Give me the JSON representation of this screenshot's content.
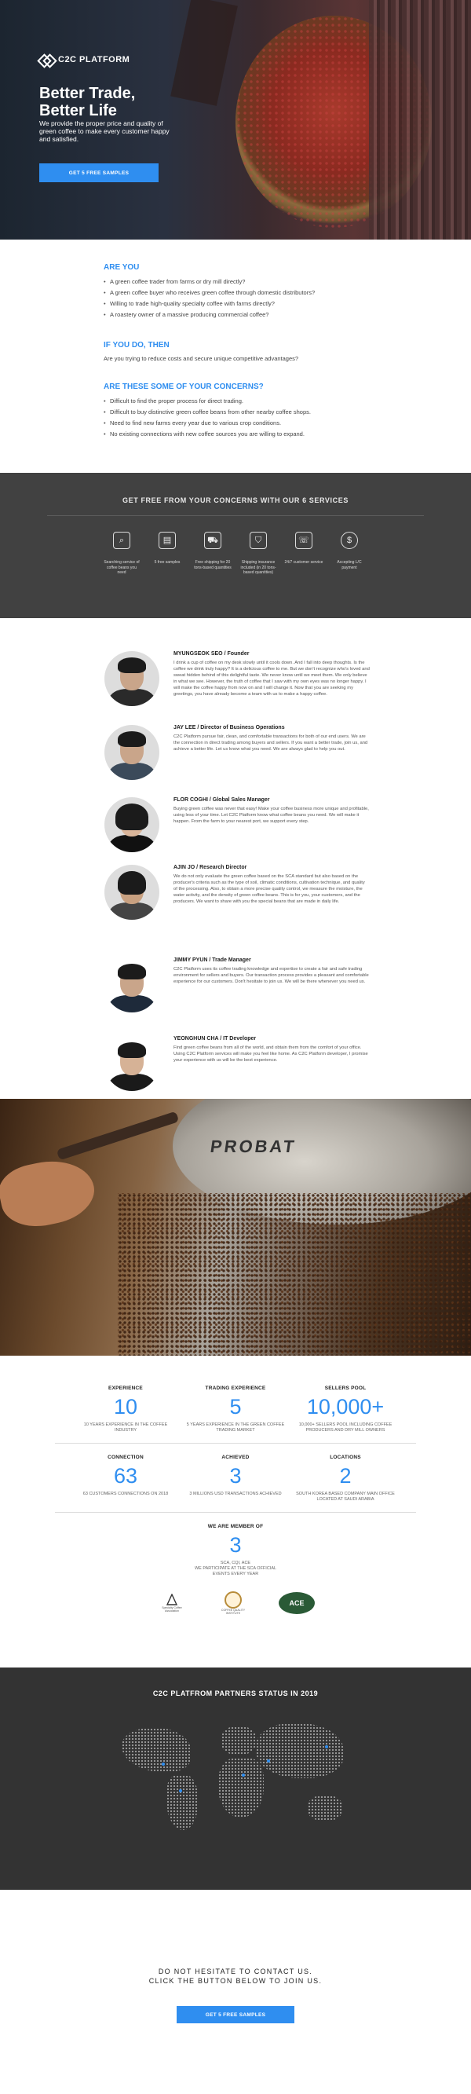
{
  "hero": {
    "brand": "C2C PLATFORM",
    "title_line1": "Better Trade,",
    "title_line2": "Better Life",
    "subtitle": "We provide the proper price and quality of green coffee to make every customer happy and satisfied.",
    "cta": "GET 5 FREE SAMPLES"
  },
  "questions": {
    "are_you": {
      "heading": "ARE YOU",
      "items": [
        "A green coffee trader from farms or dry mill directly?",
        "A green coffee buyer who receives green coffee through domestic distributors?",
        "Willing to trade high-quality specialty coffee with farms directly?",
        "A roastery owner of a massive producing commercial coffee?"
      ]
    },
    "if_you_do": {
      "heading": "IF YOU DO, THEN",
      "text": "Are you trying to reduce costs and secure unique competitive advantages?"
    },
    "concerns": {
      "heading": "ARE THESE SOME OF YOUR CONCERNS?",
      "items": [
        "Difficult to find the proper process for direct trading.",
        "Difficult to buy distinctive green coffee beans from other nearby coffee shops.",
        "Need to find new farms every year due to various crop conditions.",
        "No existing connections with new coffee sources you are willing to expand."
      ]
    }
  },
  "services": {
    "title": "GET FREE FROM YOUR CONCERNS WITH OUR 6 SERVICES",
    "items": [
      {
        "icon": "search-document-icon",
        "glyph": "⌕",
        "label": "Searching service of coffee beans you need"
      },
      {
        "icon": "sample-bag-icon",
        "glyph": "▤",
        "label": "5 free samples"
      },
      {
        "icon": "truck-icon",
        "glyph": "⛟",
        "label": "Free shipping for 20 tons-based quantities"
      },
      {
        "icon": "shield-icon",
        "glyph": "⛉",
        "label": "Shipping insurance included (in 20 tons-based quantities)"
      },
      {
        "icon": "support-icon",
        "glyph": "☏",
        "label": "24/7 customer service"
      },
      {
        "icon": "payment-icon",
        "glyph": "$",
        "label": "Accepting L/C payment"
      }
    ]
  },
  "team": [
    {
      "name": "MYUNGSEOK SEO / Founder",
      "bio": "I drink a cup of coffee on my desk slowly until it cools down. And I fall into deep thoughts. Is the coffee we drink truly happy? It is a delicious coffee to me. But we don't recognize who's loved and sweat hidden behind of this delightful taste. We never know until we meet them. We only believe in what we see. However, the truth of coffee that I saw with my own eyes was no longer happy. I will make the coffee happy from now on and I will change it. Now that you are seeking my greetings, you have already become a team with us to make a happy coffee."
    },
    {
      "name": "JAY LEE / Director of Business Operations",
      "bio": "C2C Platform pursue fair, clean, and comfortable transactions for both of our end users. We are the connection in direct trading among buyers and sellers. If you want a better trade, join us, and achieve a better life. Let us know what you need. We are always glad to help you out."
    },
    {
      "name": "FLOR COGHI / Global Sales Manager",
      "bio": "Buying green coffee was never that easy! Make your coffee business more unique and profitable, using less of your time. Let C2C Platform know what coffee beans you need. We will make it happen. From the farm to your nearest port, we support every step."
    },
    {
      "name": "AJIN JO / Research Director",
      "bio": "We do not only evaluate the green coffee based on the SCA standard but also based on the producer's criteria such as the type of soil, climatic conditions, cultivation technique, and quality of the processing. Also, to obtain a more precise quality control, we measure the moisture, the water activity, and the density of green coffee beans. This is for you, your customers, and the producers. We want to share with you the special beans that are made in daily life."
    },
    {
      "name": "JIMMY PYUN / Trade Manager",
      "bio": "C2C Platform uses its coffee trading knowledge and expertise to create a fair and safe trading environment for sellers and buyers. Our transaction process provides a pleasant and comfortable experience for our customers. Don't hesitate to join us. We will be there whenever you need us."
    },
    {
      "name": "YEONGHUN CHA / IT Developer",
      "bio": "Find green coffee beans from all of the world, and obtain them from the comfort of your office. Using C2C Platform services will make you feel like home. As C2C Platform developer, I promise your experience with us will be the best experience."
    }
  ],
  "stats": {
    "row1": [
      {
        "head": "EXPERIENCE",
        "num": "10",
        "desc": "10 YEARS EXPERIENCE IN THE COFFEE INDUSTRY"
      },
      {
        "head": "TRADING EXPERIENCE",
        "num": "5",
        "desc": "5 YEARS EXPERIENCE IN THE GREEN COFFEE TRADING MARKET"
      },
      {
        "head": "SELLERS POOL",
        "num": "10,000+",
        "desc": "10,000+ SELLERS POOL INCLUDING COFFEE PRODUCERS AND DRY MILL OWNERS"
      }
    ],
    "row2": [
      {
        "head": "CONNECTION",
        "num": "63",
        "desc": "63 CUSTOMERS CONNECTIONS ON 2018"
      },
      {
        "head": "ACHIEVED",
        "num": "3",
        "desc": "3 MILLIONS USD TRANSACTIONS ACHIEVED"
      },
      {
        "head": "LOCATIONS",
        "num": "2",
        "desc": "SOUTH KOREA BASED COMPANY MAIN OFFICE LOCATED AT SAUDI ARABIA"
      }
    ],
    "member": {
      "head": "WE ARE MEMBER OF",
      "num": "3",
      "desc_line1": "SCA, CQI, ACE",
      "desc_line2": "WE PARTICIPATE AT THE SCA OFFICIAL EVENTS EVERY YEAR"
    },
    "member_logos": [
      {
        "icon": "sca-logo",
        "text": "Specialty Coffee Association"
      },
      {
        "icon": "cqi-logo",
        "text": "COFFEE QUALITY INSTITUTE"
      },
      {
        "icon": "ace-logo",
        "text": "ACE"
      }
    ]
  },
  "partners": {
    "title": "C2C PLATFROM PARTNERS STATUS IN 2019"
  },
  "contact": {
    "line1": "DO NOT HESITATE TO CONTACT US.",
    "line2": "CLICK THE BUTTON BELOW TO JOIN US.",
    "cta": "GET 5 FREE SAMPLES"
  },
  "colors": {
    "accent": "#2f8ef0",
    "dark_band": "#414141",
    "partners_band": "#333333"
  }
}
